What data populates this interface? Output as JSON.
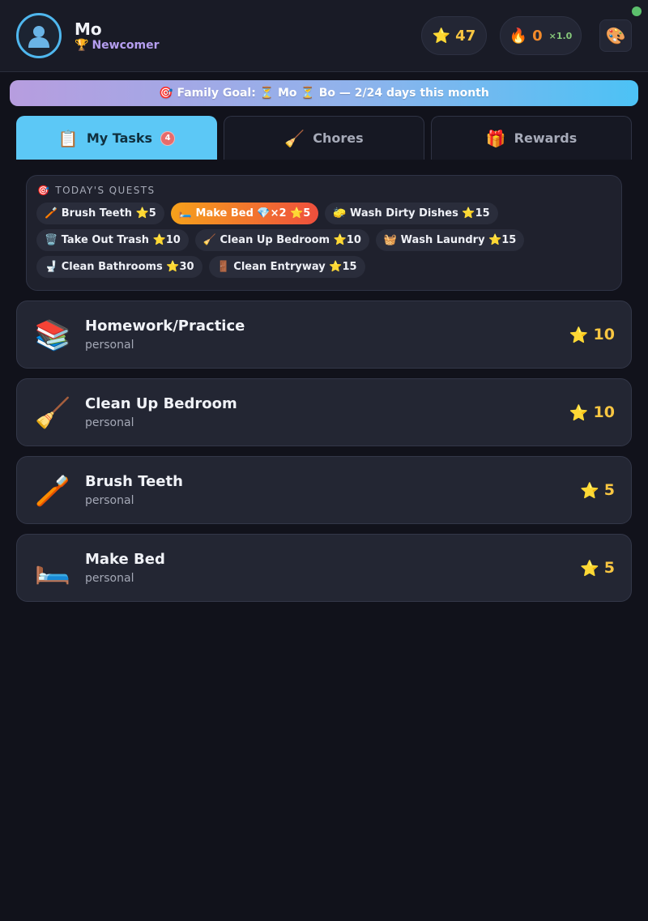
{
  "user": {
    "name": "Mo",
    "rank_icon": "trophy-icon",
    "rank": "Newcomer"
  },
  "stats": {
    "stars": "47",
    "streak": "0",
    "multiplier": "×1.0"
  },
  "goal_banner": {
    "text": "🎯 Family Goal: ⏳ Mo ⏳ Bo — 2/24 days this month"
  },
  "tabs": [
    {
      "icon": "📋",
      "label": "My Tasks",
      "badge": "4",
      "active": true
    },
    {
      "icon": "🧹",
      "label": "Chores"
    },
    {
      "icon": "🎁",
      "label": "Rewards"
    }
  ],
  "quests": {
    "title": "TODAY'S QUESTS",
    "chips": [
      {
        "label": "🪥 Brush Teeth ⭐5"
      },
      {
        "label": "🛏️ Make Bed 💎×2 ⭐5",
        "featured": true
      },
      {
        "label": "🧽 Wash Dirty Dishes ⭐15"
      },
      {
        "label": "🗑️ Take Out Trash ⭐10"
      },
      {
        "label": "🧹 Clean Up Bedroom ⭐10"
      },
      {
        "label": "🧺 Wash Laundry ⭐15"
      },
      {
        "label": "🚽 Clean Bathrooms ⭐30"
      },
      {
        "label": "🚪 Clean Entryway ⭐15"
      }
    ]
  },
  "tasks": [
    {
      "icon": "📚",
      "icon_name": "books-icon",
      "title": "Homework/Practice",
      "category": "personal",
      "points": "10"
    },
    {
      "icon": "🧹",
      "icon_name": "broom-icon",
      "title": "Clean Up Bedroom",
      "category": "personal",
      "points": "10"
    },
    {
      "icon": "🪥",
      "icon_name": "toothbrush-icon",
      "title": "Brush Teeth",
      "category": "personal",
      "points": "5"
    },
    {
      "icon": "🛏️",
      "icon_name": "bed-icon",
      "title": "Make Bed",
      "category": "personal",
      "points": "5"
    }
  ],
  "colors": {
    "background": "#11121b",
    "accent": "#5cc8f6",
    "star": "#f8c642",
    "streak": "#f38a2a",
    "online": "#5cc06d"
  }
}
